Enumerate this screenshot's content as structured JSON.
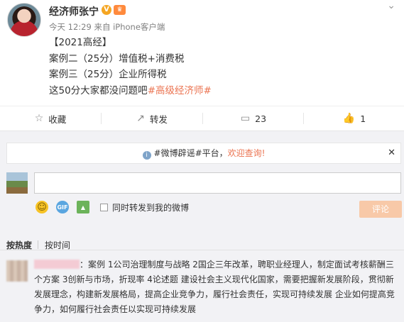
{
  "post": {
    "author": "经济师张宁",
    "meta": "今天 12:29 来自 iPhone客户端",
    "lines": {
      "l1": "【2021高经】",
      "l2": "案例二（25分）增值税+消费税",
      "l3": "案例三（25分）企业所得税",
      "l4_text": "这50分大家都没问题吧",
      "l4_topic": "#高级经济师#"
    },
    "icons": {
      "verified": "V",
      "chevron": "⌄"
    }
  },
  "actions": {
    "favorite": "收藏",
    "forward": "转发",
    "comment": "23",
    "like": "1"
  },
  "notice": {
    "prefix": "#微博辟谣#平台，",
    "highlight": "欢迎查询!",
    "close": "✕"
  },
  "composer": {
    "forward_label": "同时转发到我的微博",
    "submit": "评论",
    "gif": "GIF"
  },
  "sort": {
    "hot": "按热度",
    "time": "按时间"
  },
  "comment": {
    "text": "：案例 1公司治理制度与战略 2国企三年改革，聘职业经理人，制定面试考核薪酬三个方案 3创新与市场，折现率 4论述题 建设社会主义现代化国家，需要把握新发展阶段，贯彻新发展理念，构建新发展格局，提高企业竞争力，履行社会责任，实现可持续发展 企业如何提高竞争力，如何履行社会责任以实现可持续发展"
  },
  "colors": {
    "accent": "#eb7350",
    "submit_bg": "#f8c9a8"
  }
}
